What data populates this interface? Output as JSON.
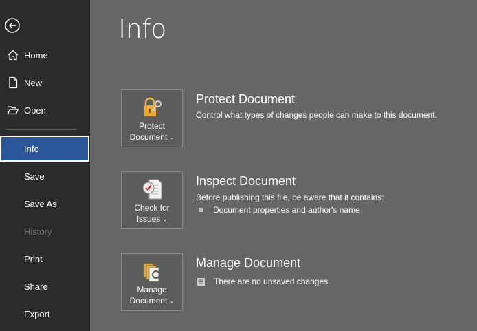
{
  "nav": {
    "back_icon": "back-arrow-icon",
    "items": [
      {
        "label": "Home",
        "icon": "home-icon"
      },
      {
        "label": "New",
        "icon": "new-document-icon"
      },
      {
        "label": "Open",
        "icon": "open-folder-icon"
      },
      {
        "label": "Info",
        "active": true
      },
      {
        "label": "Save"
      },
      {
        "label": "Save As"
      },
      {
        "label": "History",
        "disabled": true
      },
      {
        "label": "Print"
      },
      {
        "label": "Share"
      },
      {
        "label": "Export"
      }
    ]
  },
  "page": {
    "title": "Info"
  },
  "sections": [
    {
      "tile_line1": "Protect",
      "tile_line2": "Document",
      "icon": "lock-icon",
      "title": "Protect Document",
      "description": "Control what types of changes people can make to this document."
    },
    {
      "tile_line1": "Check for",
      "tile_line2": "Issues",
      "icon": "inspect-document-icon",
      "title": "Inspect Document",
      "description": "Before publishing this file, be aware that it contains:",
      "bullet": "Document properties and author's name"
    },
    {
      "tile_line1": "Manage",
      "tile_line2": "Document",
      "icon": "manage-document-icon",
      "title": "Manage Document",
      "status": "There are no unsaved changes."
    }
  ],
  "colors": {
    "sidebar_bg": "#2b2b2b",
    "main_bg": "#666666",
    "active_item": "#2b579a"
  }
}
